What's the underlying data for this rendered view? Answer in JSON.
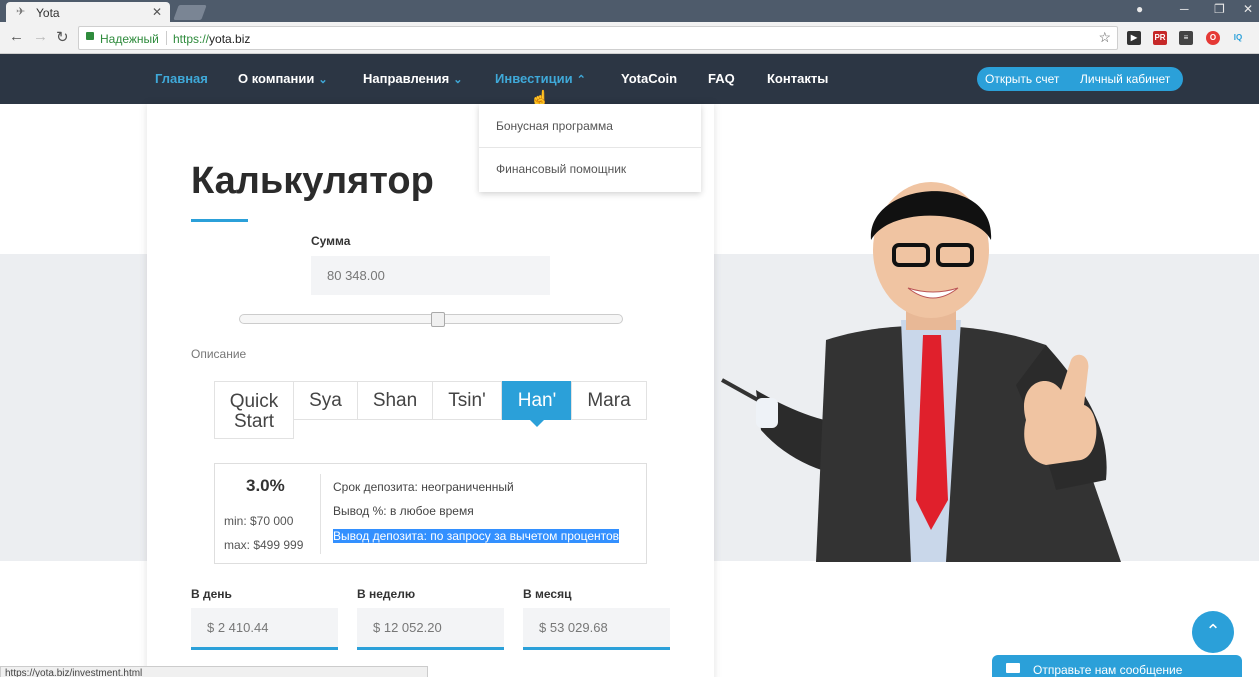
{
  "browser": {
    "tab_title": "Yota",
    "secure_label": "Надежный",
    "url_scheme": "https://",
    "url_host": "yota.biz",
    "status_url": "https://yota.biz/investment.html"
  },
  "nav": {
    "items": [
      "Главная",
      "О компании",
      "Направления",
      "Инвестиции",
      "YotaCoin",
      "FAQ",
      "Контакты"
    ],
    "open_account": "Открыть счет",
    "cabinet": "Личный кабинет"
  },
  "dropdown": {
    "items": [
      "Бонусная программа",
      "Финансовый помощник"
    ]
  },
  "calc": {
    "title": "Калькулятор",
    "sum_label": "Сумма",
    "sum_value": "80 348.00",
    "slider_fraction": 0.52,
    "desc_label": "Описание",
    "plans": [
      "Quick Start",
      "Sya",
      "Shan",
      "Tsin'",
      "Han'",
      "Mara"
    ],
    "active_plan": "Han'",
    "rate": "3.0%",
    "min": "min: $70 000",
    "max": "max: $499 999",
    "term": "Срок депозита: неограниченный",
    "withdraw_pct": "Вывод %: в любое время",
    "withdraw_dep": "Вывод депозита: по запросу за вычетом процентов",
    "per_day_label": "В день",
    "per_day": "$ 2 410.44",
    "per_week_label": "В неделю",
    "per_week": "$ 12 052.20",
    "per_month_label": "В месяц",
    "per_month": "$ 53 029.68"
  },
  "chat": {
    "label": "Отправьте нам сообщение"
  },
  "colors": {
    "accent": "#2ba0d9",
    "nav_bg": "#2c3644"
  }
}
